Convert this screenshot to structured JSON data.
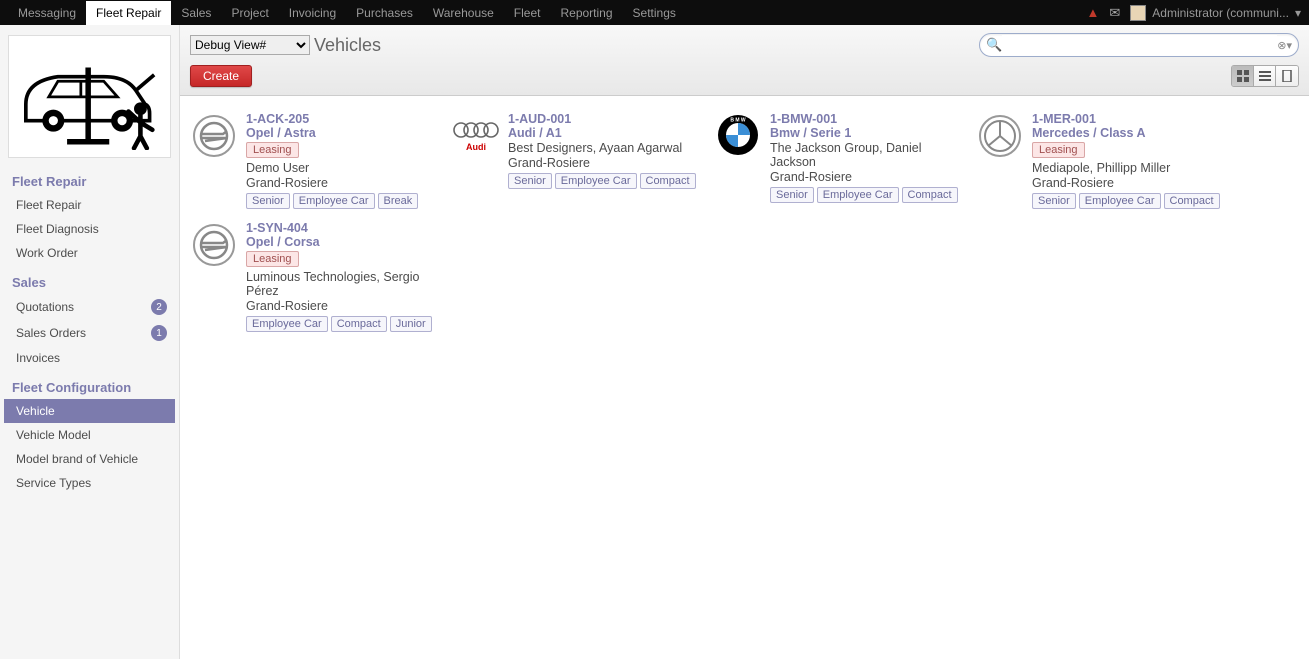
{
  "topnav": {
    "items": [
      "Messaging",
      "Fleet Repair",
      "Sales",
      "Project",
      "Invoicing",
      "Purchases",
      "Warehouse",
      "Fleet",
      "Reporting",
      "Settings"
    ],
    "active_index": 1,
    "user_label": "Administrator (communi...",
    "dropdown_arrow": "▾"
  },
  "sidebar": {
    "sections": [
      {
        "title": "Fleet Repair",
        "items": [
          {
            "label": "Fleet Repair",
            "active": false
          },
          {
            "label": "Fleet Diagnosis",
            "active": false
          },
          {
            "label": "Work Order",
            "active": false
          }
        ]
      },
      {
        "title": "Sales",
        "items": [
          {
            "label": "Quotations",
            "badge": "2",
            "active": false
          },
          {
            "label": "Sales Orders",
            "badge": "1",
            "active": false
          },
          {
            "label": "Invoices",
            "active": false
          }
        ]
      },
      {
        "title": "Fleet Configuration",
        "items": [
          {
            "label": "Vehicle",
            "active": true
          },
          {
            "label": "Vehicle Model",
            "active": false
          },
          {
            "label": "Model brand of Vehicle",
            "active": false
          },
          {
            "label": "Service Types",
            "active": false
          }
        ]
      }
    ]
  },
  "toolbar": {
    "debug_label": "Debug View#",
    "page_title": "Vehicles",
    "create_label": "Create",
    "search_placeholder": ""
  },
  "vehicles": [
    {
      "plate": "1-ACK-205",
      "model": "Opel / Astra",
      "leasing": true,
      "customer": "Demo User",
      "location": "Grand-Rosiere",
      "tags": [
        "Senior",
        "Employee Car",
        "Break"
      ],
      "brand": "opel"
    },
    {
      "plate": "1-AUD-001",
      "model": "Audi / A1",
      "leasing": false,
      "customer": "Best Designers, Ayaan Agarwal",
      "location": "Grand-Rosiere",
      "tags": [
        "Senior",
        "Employee Car",
        "Compact"
      ],
      "brand": "audi"
    },
    {
      "plate": "1-BMW-001",
      "model": "Bmw / Serie 1",
      "leasing": false,
      "customer": "The Jackson Group, Daniel Jackson",
      "location": "Grand-Rosiere",
      "tags": [
        "Senior",
        "Employee Car",
        "Compact"
      ],
      "brand": "bmw"
    },
    {
      "plate": "1-MER-001",
      "model": "Mercedes / Class A",
      "leasing": true,
      "customer": "Mediapole, Phillipp Miller",
      "location": "Grand-Rosiere",
      "tags": [
        "Senior",
        "Employee Car",
        "Compact"
      ],
      "brand": "mercedes"
    },
    {
      "plate": "1-SYN-404",
      "model": "Opel / Corsa",
      "leasing": true,
      "customer": "Luminous Technologies, Sergio Pérez",
      "location": "Grand-Rosiere",
      "tags": [
        "Employee Car",
        "Compact",
        "Junior"
      ],
      "brand": "opel"
    }
  ]
}
